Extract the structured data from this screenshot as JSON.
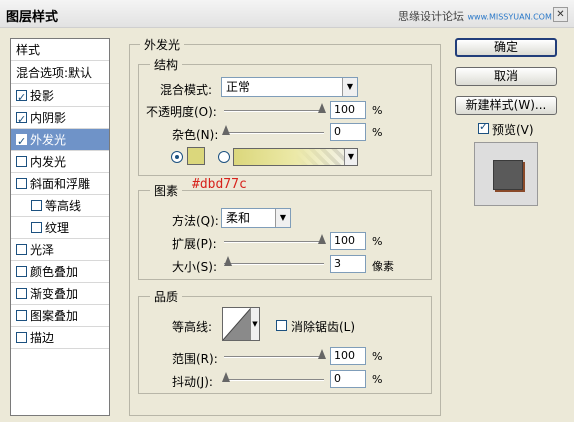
{
  "window": {
    "title": "图层样式",
    "watermark_cn": "思缘设计论坛",
    "watermark_en": "www.MISSYUAN.COM",
    "close_glyph": "✕"
  },
  "left_panel": {
    "header": "样式",
    "blend_options": "混合选项:默认",
    "items": [
      {
        "label": "投影",
        "checked": true
      },
      {
        "label": "内阴影",
        "checked": true
      },
      {
        "label": "外发光",
        "checked": true,
        "selected": true
      },
      {
        "label": "内发光",
        "checked": false
      },
      {
        "label": "斜面和浮雕",
        "checked": false
      },
      {
        "label": "等高线",
        "checked": false,
        "indent": true
      },
      {
        "label": "纹理",
        "checked": false,
        "indent": true
      },
      {
        "label": "光泽",
        "checked": false
      },
      {
        "label": "颜色叠加",
        "checked": false
      },
      {
        "label": "渐变叠加",
        "checked": false
      },
      {
        "label": "图案叠加",
        "checked": false
      },
      {
        "label": "描边",
        "checked": false
      }
    ]
  },
  "outer_glow": {
    "title": "外发光",
    "structure": {
      "title": "结构",
      "blend_mode_label": "混合模式:",
      "blend_mode_value": "正常",
      "opacity_label": "不透明度(O):",
      "opacity_value": "100",
      "noise_label": "杂色(N):",
      "noise_value": "0",
      "percent": "%",
      "glow_color": "#dbd77c"
    },
    "elements": {
      "title": "图素",
      "annotation": "#dbd77c",
      "technique_label": "方法(Q):",
      "technique_value": "柔和",
      "spread_label": "扩展(P):",
      "spread_value": "100",
      "size_label": "大小(S):",
      "size_value": "3",
      "size_unit": "像素",
      "percent": "%"
    },
    "quality": {
      "title": "品质",
      "contour_label": "等高线:",
      "antialias_label": "消除锯齿(L)",
      "antialias_checked": false,
      "range_label": "范围(R):",
      "range_value": "100",
      "jitter_label": "抖动(J):",
      "jitter_value": "0",
      "percent": "%"
    }
  },
  "right_panel": {
    "ok": "确定",
    "cancel": "取消",
    "new_style": "新建样式(W)...",
    "preview_label": "预览(V)",
    "preview_checked": true
  }
}
